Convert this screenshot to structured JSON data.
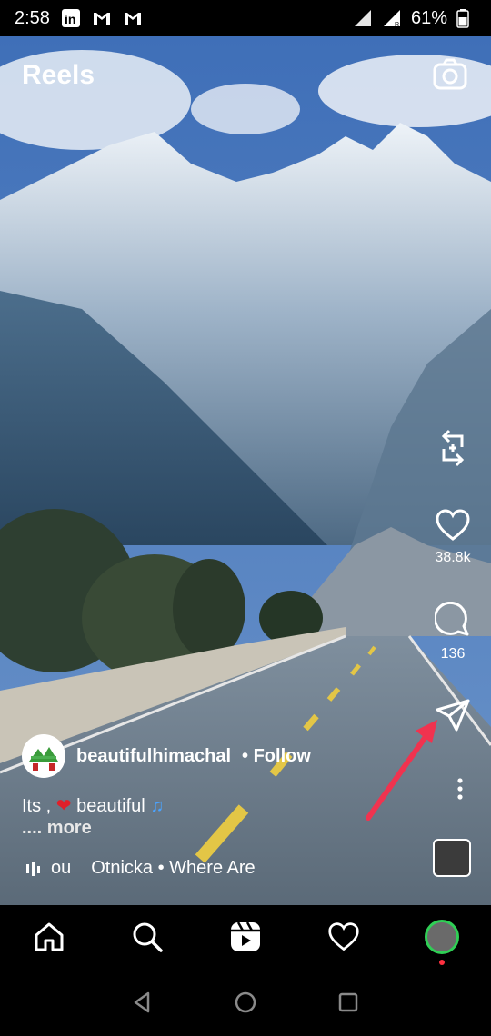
{
  "status_bar": {
    "time": "2:58",
    "battery": "61%",
    "icons": [
      "linkedin-icon",
      "gmail-icon",
      "gmail-icon",
      "signal-icon",
      "signal-roaming-icon",
      "battery-icon"
    ]
  },
  "header": {
    "title": "Reels",
    "camera_icon": "camera-icon"
  },
  "side_actions": {
    "remix_icon": "remix-icon",
    "like_icon": "heart-icon",
    "like_count": "38.8k",
    "comment_icon": "comment-icon",
    "comment_count": "136",
    "share_icon": "share-icon",
    "more_icon": "more-vertical-icon"
  },
  "post": {
    "author": "beautifulhimachal",
    "follow_label": "• Follow",
    "caption_start": "Its ,",
    "caption_end": "beautiful",
    "more_label": ".... more",
    "audio_text_1": "ou",
    "audio_text_2": "Otnicka • Where Are"
  },
  "bottom_nav": {
    "items": [
      "home-icon",
      "search-icon",
      "reels-icon",
      "heart-icon",
      "profile-avatar"
    ]
  },
  "system_nav": [
    "back-icon",
    "home-circle-icon",
    "recent-apps-icon"
  ],
  "colors": {
    "accent_arrow": "#f0334f",
    "active_ring": "#2fcf55"
  }
}
